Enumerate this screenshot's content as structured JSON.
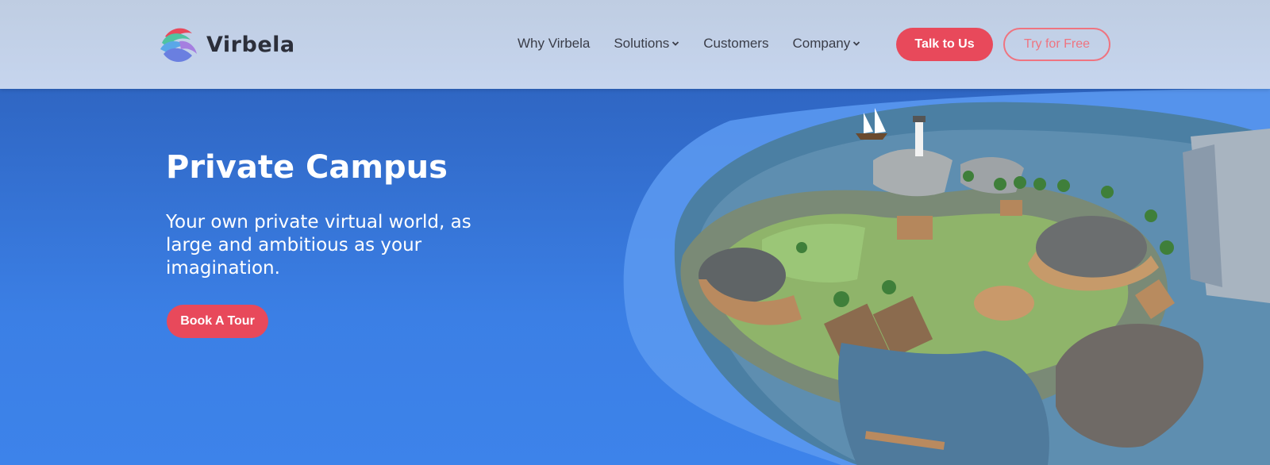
{
  "brand": {
    "name": "Virbela",
    "logo_icon": "wave-logo-icon"
  },
  "nav": {
    "items": [
      {
        "label": "Why Virbela",
        "has_dropdown": false
      },
      {
        "label": "Solutions",
        "has_dropdown": true
      },
      {
        "label": "Customers",
        "has_dropdown": false
      },
      {
        "label": "Company",
        "has_dropdown": true
      }
    ],
    "talk_label": "Talk to Us",
    "try_label": "Try for Free"
  },
  "hero": {
    "title": "Private Campus",
    "subtitle": "Your own private virtual world, as large and ambitious as your imagination.",
    "cta_label": "Book A Tour",
    "image_description_icon": "virtual-campus-island-illustration"
  },
  "colors": {
    "accent": "#e8495b",
    "accent_outline": "#ef7480",
    "hero_bg": "#3b7fe5",
    "header_bg": "#c3d1ea"
  }
}
